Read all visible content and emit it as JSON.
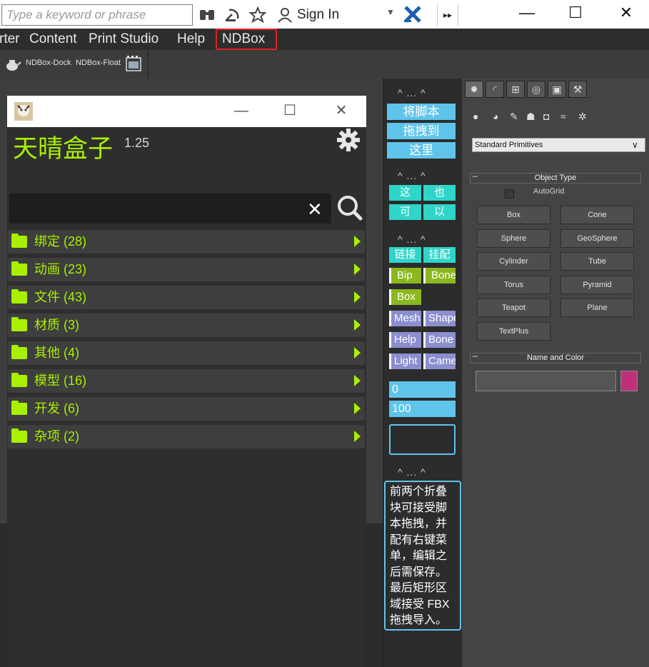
{
  "titlebar": {
    "search_placeholder": "Type a keyword or phrase",
    "icons": [
      "binoculars-icon",
      "satellite-icon",
      "star-icon",
      "user-icon"
    ],
    "sign_in": "Sign In",
    "more": "▸▸",
    "window_controls": [
      "—",
      "☐",
      "✕"
    ]
  },
  "menu": {
    "items": [
      "rter",
      "Content",
      "Print Studio",
      "Help",
      "NDBox"
    ]
  },
  "toolbar": {
    "dock_label": "NDBox-Dock",
    "float_label": "NDBox-Float"
  },
  "ndbox": {
    "title": "天晴盒子",
    "version": "1.25",
    "categories": [
      {
        "label": "绑定 (28)"
      },
      {
        "label": "动画 (23)"
      },
      {
        "label": "文件 (43)"
      },
      {
        "label": "材质 (3)"
      },
      {
        "label": "其他 (4)"
      },
      {
        "label": "模型 (16)"
      },
      {
        "label": "开发 (6)"
      },
      {
        "label": "杂项 (2)"
      }
    ],
    "accent_color": "#a8f000"
  },
  "middle": {
    "dots": "...",
    "script_drop": [
      "将脚本",
      "拖拽到",
      "这里"
    ],
    "small_btns": [
      "这",
      "也",
      "可",
      "以"
    ],
    "tool_btns": [
      "链接",
      "挂配"
    ],
    "green_btns": [
      "Bip",
      "Bone",
      "Box"
    ],
    "purple_btns": [
      "Mesh",
      "Shape",
      "Help",
      "Bone",
      "Light",
      "Camera"
    ],
    "field_a": "0",
    "field_b": "100",
    "note": "前两个折叠块可接受脚本拖拽，并配有右键菜单，编辑之后需保存。最后矩形区域接受 FBX 拖拽导入。"
  },
  "command_panel": {
    "dropdown": "Standard Primitives",
    "object_type": "Object Type",
    "autogrid": "AutoGrid",
    "buttons": [
      "Box",
      "Cone",
      "Sphere",
      "GeoSphere",
      "Cylinder",
      "Tube",
      "Torus",
      "Pyramid",
      "Teapot",
      "Plane",
      "TextPlus"
    ],
    "name_and_color": "Name and Color",
    "swatch_color": "#c0307a"
  }
}
